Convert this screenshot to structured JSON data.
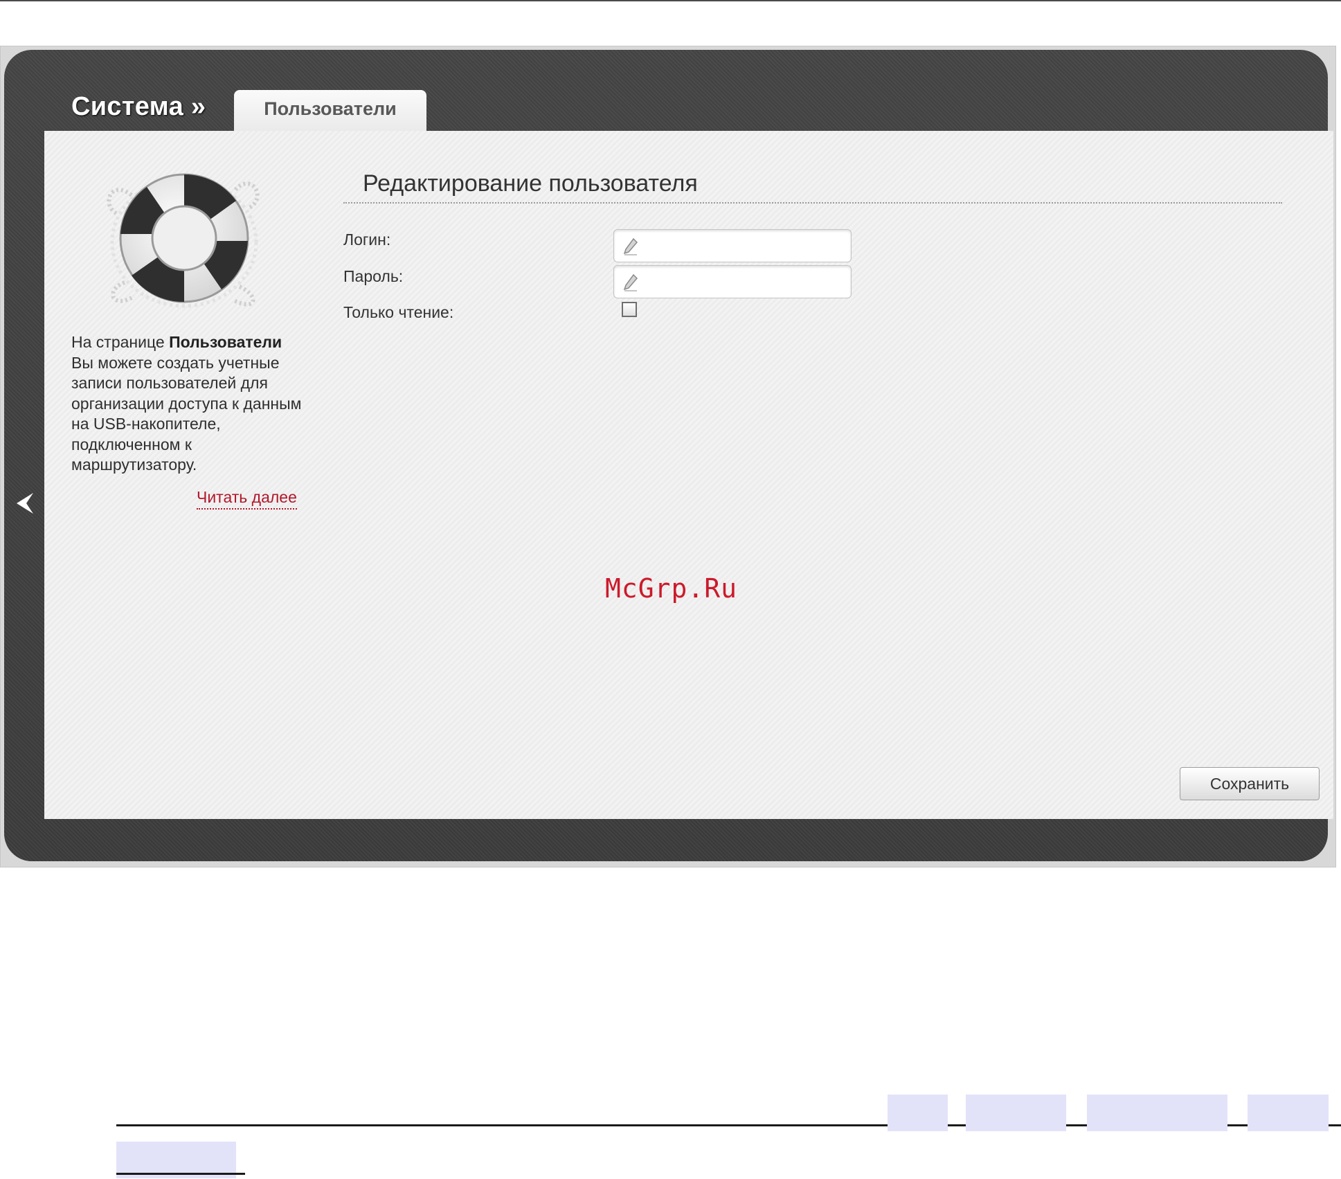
{
  "header": {
    "section_title": "Система »",
    "active_tab": "Пользователи"
  },
  "sidebar": {
    "help_lead": "На странице ",
    "help_page_name": "Пользователи",
    "help_body": " Вы можете создать учетные записи пользователей для организации доступа к данным на USB-накопителе, подключенном к маршрутизатору.",
    "read_more": "Читать далее",
    "illustration_icon": "lifebuoy-icon",
    "collapse_icon": "chevron-left-icon"
  },
  "form": {
    "title": "Редактирование пользователя",
    "login_label": "Логин:",
    "login_value": "",
    "password_label": "Пароль:",
    "password_value": "",
    "readonly_label": "Только чтение:",
    "readonly_checked": false,
    "save_label": "Сохранить"
  },
  "watermark": "McGrp.Ru",
  "colors": {
    "panel_dark": "#404040",
    "content_bg": "#efefef",
    "link_red": "#b3172a",
    "watermark_red": "#cc1a2b"
  }
}
